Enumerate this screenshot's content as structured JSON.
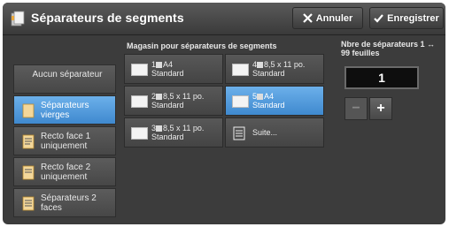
{
  "header": {
    "title": "Séparateurs de segments",
    "cancel_label": "Annuler",
    "save_label": "Enregistrer"
  },
  "left_options": [
    {
      "label": "Aucun séparateur",
      "selected": false,
      "icon": ""
    },
    {
      "label": "Séparateurs vierges",
      "selected": true,
      "icon": "blank-separator-icon"
    },
    {
      "label": "Recto face 1 uniquement",
      "selected": false,
      "icon": "printed-side1-icon"
    },
    {
      "label": "Recto face 2 uniquement",
      "selected": false,
      "icon": "printed-side2-icon"
    },
    {
      "label": "Séparateurs 2 faces",
      "selected": false,
      "icon": "duplex-separator-icon"
    }
  ],
  "trays": {
    "section_label": "Magasin pour séparateurs de segments",
    "items": [
      {
        "number": "1",
        "size": "A4",
        "type": "Standard",
        "selected": false
      },
      {
        "number": "4",
        "size": "8,5 x 11 po.",
        "type": "Standard",
        "selected": false
      },
      {
        "number": "2",
        "size": "8,5 x 11 po.",
        "type": "Standard",
        "selected": false
      },
      {
        "number": "5",
        "size": "A4",
        "type": "Standard",
        "selected": true
      },
      {
        "number": "3",
        "size": "8,5 x 11 po.",
        "type": "Standard",
        "selected": false
      }
    ],
    "more_label": "Suite..."
  },
  "count": {
    "label": "Nbre de séparateurs 1 ↔ 99 feuilles",
    "value": "1",
    "minus": "−",
    "plus": "+"
  },
  "colors": {
    "accent": "#4a95d8",
    "panel": "#3c3c3c"
  }
}
